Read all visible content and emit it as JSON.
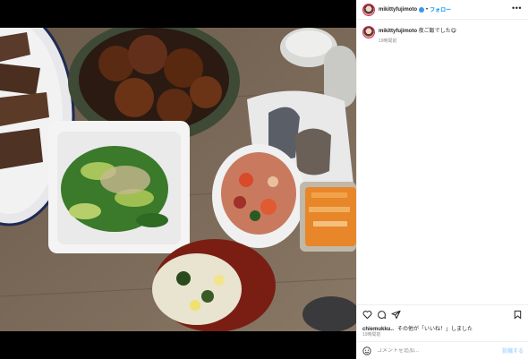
{
  "header": {
    "username": "mikittyfujimoto",
    "separator": "•",
    "follow_label": "フォロー",
    "more_label": "•••"
  },
  "caption": {
    "username": "mikittyfujimoto",
    "text": "夜ご飯でした😋",
    "time": "19時間前"
  },
  "likes": {
    "user": "chiemukku.",
    "text": "、その他が「いいね！」しました",
    "time": "19時間前"
  },
  "comment": {
    "placeholder": "コメントを追加...",
    "post_label": "投稿する"
  },
  "icons": [
    "heart-icon",
    "comment-icon",
    "share-icon",
    "bookmark-icon",
    "emoji-icon",
    "verified-badge-icon",
    "more-icon"
  ],
  "colors": {
    "link": "#0095f6",
    "badge": "#3897f0",
    "post_disabled": "#b3dbff"
  }
}
